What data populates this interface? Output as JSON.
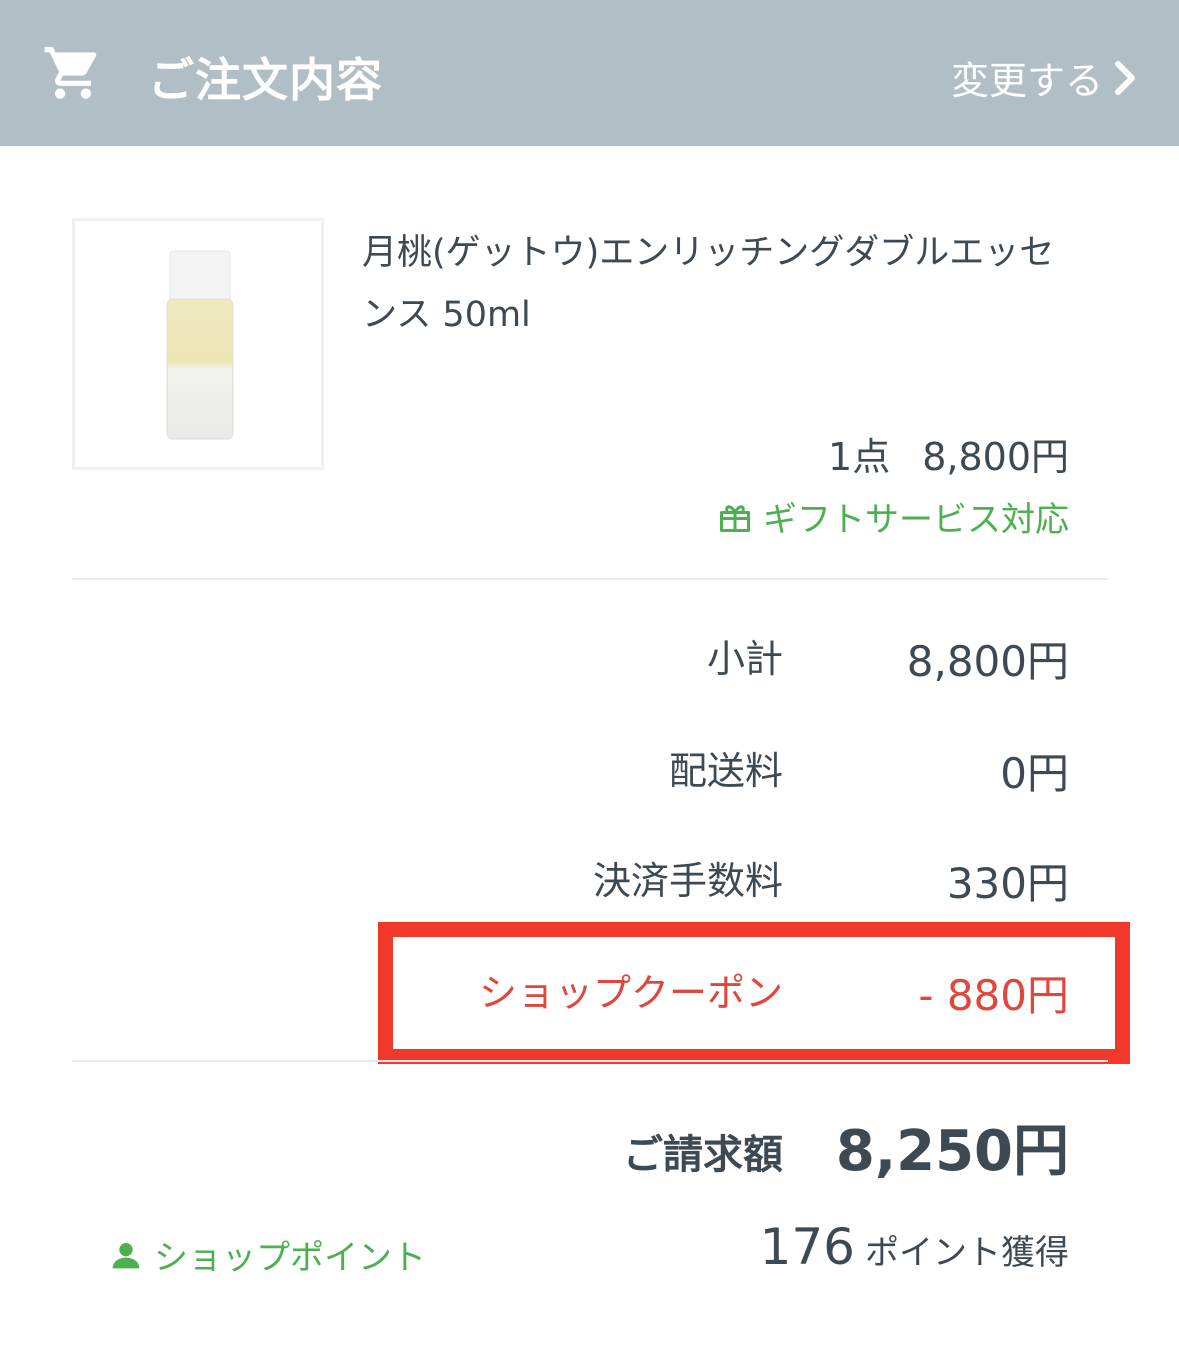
{
  "header": {
    "title": "ご注文内容",
    "change_label": "変更する",
    "icon": "cart-icon",
    "background_color": "#b1bec6"
  },
  "product": {
    "name": "月桃(ゲットウ)エンリッチングダブルエッセンス 50ml",
    "quantity": "1点",
    "price": "8,800円",
    "gift_label": "ギフトサービス対応",
    "gift_icon": "gift-icon"
  },
  "summary": {
    "subtotal_label": "小計",
    "subtotal_value": "8,800円",
    "shipping_label": "配送料",
    "shipping_value": "0円",
    "fee_label": "決済手数料",
    "fee_value": "330円",
    "coupon_label": "ショップクーポン",
    "coupon_value": "- 880円",
    "coupon_color": "#e0473c",
    "total_label": "ご請求額",
    "total_value": "8,250円"
  },
  "points": {
    "label": "ショップポイント",
    "icon": "user-icon",
    "amount": "176",
    "suffix": "ポイント獲得",
    "accent_color": "#4caf50"
  },
  "highlight_color": "#f2382b"
}
